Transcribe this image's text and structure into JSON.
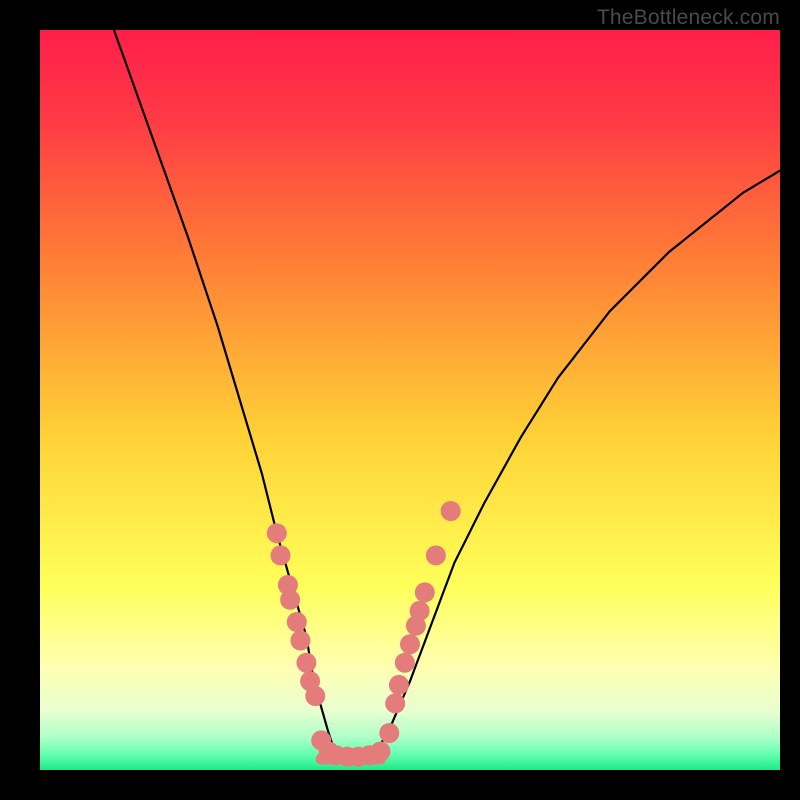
{
  "watermark": "TheBottleneck.com",
  "chart_data": {
    "type": "line",
    "title": "",
    "xlabel": "",
    "ylabel": "",
    "xlim": [
      0,
      100
    ],
    "ylim": [
      0,
      100
    ],
    "background_gradient": [
      "#ff1e4a",
      "#ff6a36",
      "#ffd236",
      "#ffff60",
      "#f6ffc0",
      "#2aff8a"
    ],
    "series": [
      {
        "name": "left-curve",
        "type": "line",
        "color": "#000000",
        "x": [
          10,
          15,
          20,
          24,
          27,
          30,
          32,
          34,
          36,
          37,
          39,
          40
        ],
        "y": [
          100,
          86,
          72,
          60,
          50,
          40,
          32,
          25,
          18,
          12,
          5,
          2
        ]
      },
      {
        "name": "right-curve",
        "type": "line",
        "color": "#000000",
        "x": [
          45,
          47,
          50,
          53,
          56,
          60,
          65,
          70,
          77,
          85,
          95,
          100
        ],
        "y": [
          2,
          5,
          12,
          20,
          28,
          36,
          45,
          53,
          62,
          70,
          78,
          81
        ]
      },
      {
        "name": "floor",
        "type": "line",
        "color": "#e47c7c",
        "x": [
          38,
          46
        ],
        "y": [
          1.5,
          1.5
        ]
      }
    ],
    "points": {
      "name": "data-points",
      "color": "#e47c7c",
      "radius": 10,
      "coords": [
        [
          32,
          32
        ],
        [
          32.5,
          29
        ],
        [
          33.5,
          25
        ],
        [
          33.8,
          23
        ],
        [
          34.7,
          20
        ],
        [
          35.2,
          17.5
        ],
        [
          36,
          14.5
        ],
        [
          36.5,
          12
        ],
        [
          37.2,
          10
        ],
        [
          38,
          4
        ],
        [
          39,
          2.5
        ],
        [
          40,
          2
        ],
        [
          41.5,
          1.8
        ],
        [
          43,
          1.8
        ],
        [
          44.5,
          2
        ],
        [
          46,
          2.5
        ],
        [
          47.2,
          5
        ],
        [
          48,
          9
        ],
        [
          48.5,
          11.5
        ],
        [
          49.3,
          14.5
        ],
        [
          50,
          17
        ],
        [
          50.8,
          19.5
        ],
        [
          51.3,
          21.5
        ],
        [
          52,
          24
        ],
        [
          53.5,
          29
        ],
        [
          55.5,
          35
        ]
      ]
    }
  }
}
